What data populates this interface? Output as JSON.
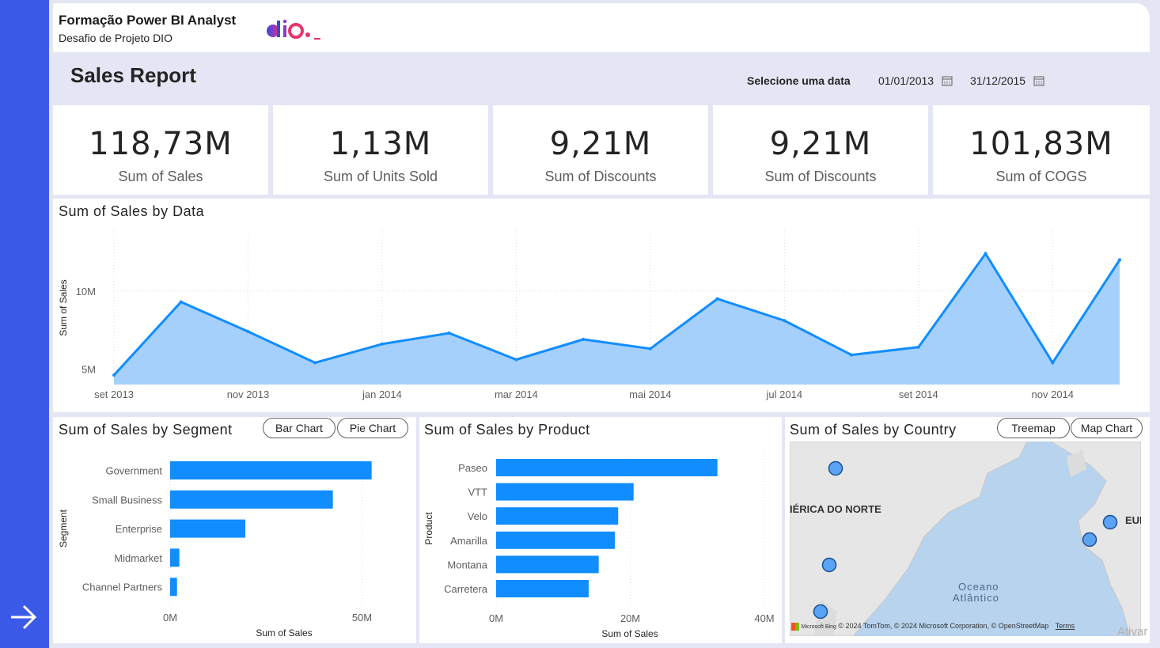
{
  "header": {
    "title": "Formação Power BI Analyst",
    "subtitle": "Desafio de Projeto DIO"
  },
  "report": {
    "title": "Sales Report",
    "date_label": "Selecione uma data",
    "date_start": "01/01/2013",
    "date_end": "31/12/2015"
  },
  "kpis": [
    {
      "value": "118,73M",
      "label": "Sum of  Sales"
    },
    {
      "value": "1,13M",
      "label": "Sum of Units Sold"
    },
    {
      "value": "9,21M",
      "label": "Sum of Discounts"
    },
    {
      "value": "9,21M",
      "label": "Sum of Discounts"
    },
    {
      "value": "101,83M",
      "label": "Sum of COGS"
    }
  ],
  "line_panel": {
    "title": "Sum of Sales by Data"
  },
  "segment_panel": {
    "title": "Sum of Sales by Segment",
    "buttons": [
      "Bar Chart",
      "Pie Chart"
    ]
  },
  "product_panel": {
    "title": "Sum of Sales by Product"
  },
  "country_panel": {
    "title": "Sum of Sales by Country",
    "buttons": [
      "Treemap",
      "Map Chart"
    ],
    "map_labels": [
      "IÉRICA DO NORTE",
      "EUI",
      "Oceano",
      "Atlântico"
    ],
    "attribution": "Microsoft Bing",
    "attribution_2": "© 2024 TomTom, © 2024 Microsoft Corporation, © OpenStreetMap",
    "terms": "Terms"
  },
  "watermark": "Ativar",
  "colors": {
    "accent": "#118dff",
    "area": "#9fcefb",
    "sidebar": "#3c5ae8"
  },
  "chart_data": [
    {
      "type": "area",
      "ylabel": "Sum of Sales",
      "x": [
        "set 2013",
        "out 2013",
        "nov 2013",
        "dez 2013",
        "jan 2014",
        "fev 2014",
        "mar 2014",
        "abr 2014",
        "mai 2014",
        "jun 2014",
        "jul 2014",
        "ago 2014",
        "set 2014",
        "out 2014",
        "nov 2014",
        "dez 2014"
      ],
      "xticks": [
        "set 2013",
        "nov 2013",
        "jan 2014",
        "mar 2014",
        "mai 2014",
        "jul 2014",
        "set 2014",
        "nov 2014"
      ],
      "yticks": [
        "5M",
        "10M"
      ],
      "values": [
        4.6,
        9.3,
        7.4,
        5.4,
        6.6,
        7.3,
        5.6,
        6.9,
        6.3,
        9.5,
        8.1,
        5.9,
        6.4,
        12.4,
        5.4,
        12.0
      ],
      "ylim": [
        4.0,
        13.9
      ],
      "grid": true
    },
    {
      "type": "bar",
      "orientation": "horizontal",
      "xlabel": "Sum of Sales",
      "ylabel": "Segment",
      "categories": [
        "Government",
        "Small Business",
        "Enterprise",
        "Midmarket",
        "Channel Partners"
      ],
      "values": [
        52.5,
        42.4,
        19.6,
        2.4,
        1.8
      ],
      "xticks": [
        "0M",
        "50M"
      ],
      "xlim": [
        0,
        60
      ]
    },
    {
      "type": "bar",
      "orientation": "horizontal",
      "xlabel": "Sum of Sales",
      "ylabel": "Product",
      "categories": [
        "Paseo",
        "VTT",
        "Velo",
        "Amarilla",
        "Montana",
        "Carretera"
      ],
      "values": [
        33.0,
        20.5,
        18.2,
        17.7,
        15.3,
        13.8
      ],
      "xticks": [
        "0M",
        "20M",
        "40M"
      ],
      "xlim": [
        0,
        40
      ]
    }
  ]
}
